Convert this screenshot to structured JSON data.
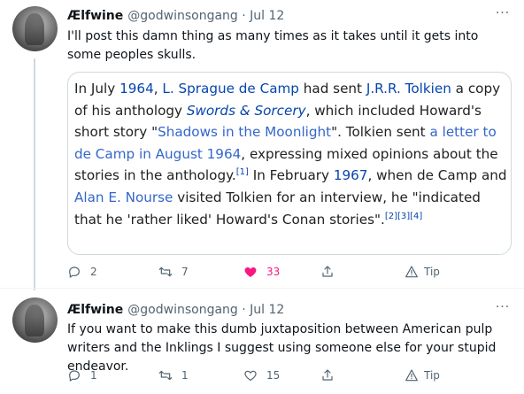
{
  "tweets": [
    {
      "author_name": "Ælfwine",
      "handle_date": "@godwinsongang · Jul 12",
      "text": "I'll post this damn thing as many times as it takes until it gets into some peoples skulls.",
      "quote": {
        "p1": "In July ",
        "l1": "1964",
        "p2": ", ",
        "l2": "L. Sprague de Camp",
        "p3": " had sent ",
        "l3": "J.R.R. Tolkien",
        "p4": " a copy of his anthology ",
        "l4": "Swords & Sorcery",
        "p5": ", which included Howard's short story \"",
        "l5": "Shadows in the Moonlight",
        "p6": "\". Tolkien sent ",
        "l6": "a letter to de Camp in August 1964",
        "p7": ", expressing mixed opinions about the stories in the anthology.",
        "r1": "[1]",
        "p8": " In February ",
        "l7": "1967",
        "p9": ", when de Camp and ",
        "l8": "Alan E. Nourse",
        "p10": " visited Tolkien for an interview, he \"indicated that he 'rather liked' Howard's Conan stories\".",
        "r2": "[2][3][4]"
      },
      "replies": "2",
      "retweets": "7",
      "likes": "33",
      "tip": "Tip"
    },
    {
      "author_name": "Ælfwine",
      "handle_date": "@godwinsongang · Jul 12",
      "text": "If you want to make this dumb juxtaposition between American pulp writers and the Inklings I suggest using someone else for your stupid endeavor.",
      "replies": "1",
      "retweets": "1",
      "likes": "15",
      "tip": "Tip"
    }
  ],
  "colors": {
    "like": "#f91880",
    "link": "#0645ad",
    "muted": "#536471"
  }
}
